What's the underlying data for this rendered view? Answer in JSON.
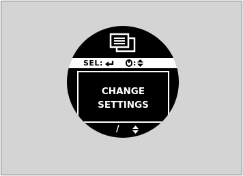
{
  "display": {
    "icon": "menu-screen-icon",
    "selector_label": "SEL:",
    "selector_enter_icon": "enter-arrow-icon",
    "selector_knob_icon": "knob-icon",
    "selector_colon": ":",
    "selector_updown_icon": "up-down-arrows-icon",
    "menu_title_line1": "CHANGE",
    "menu_title_line2": "SETTINGS",
    "footer_slash": "/",
    "footer_updown_icon": "up-down-arrows-icon"
  },
  "colors": {
    "background": "#d4d4d4",
    "dial": "#000000",
    "text_on_dial": "#ffffff",
    "text_on_bar": "#000000"
  }
}
